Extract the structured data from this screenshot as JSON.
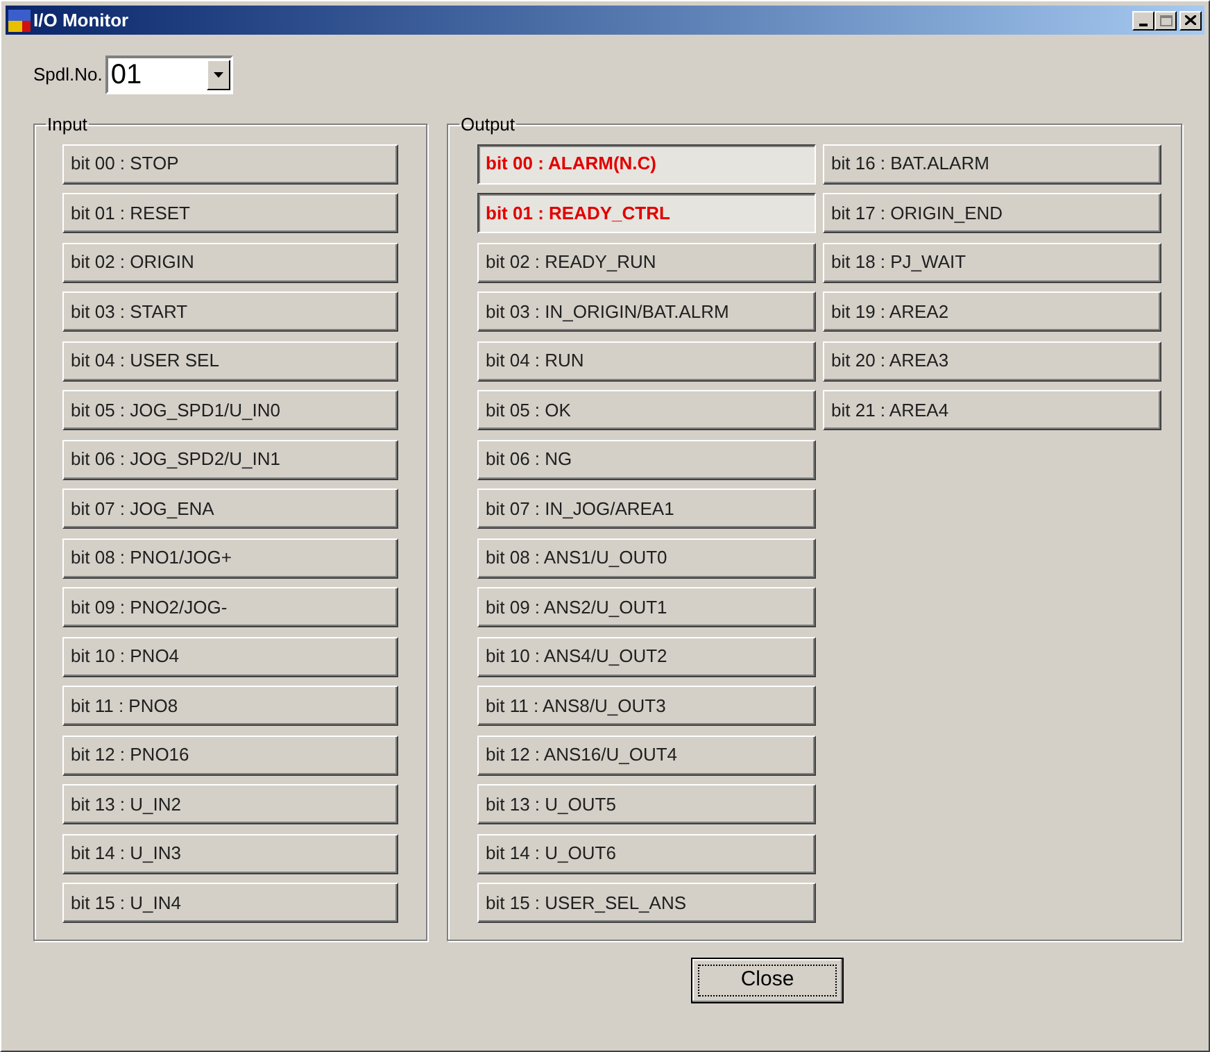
{
  "window": {
    "title": "I/O Monitor"
  },
  "spindle": {
    "label": "Spdl.No.",
    "value": "01"
  },
  "input": {
    "title": "Input",
    "bits": [
      {
        "label": "bit 00 : STOP",
        "on": false
      },
      {
        "label": "bit 01 : RESET",
        "on": false
      },
      {
        "label": "bit 02 : ORIGIN",
        "on": false
      },
      {
        "label": "bit 03 : START",
        "on": false
      },
      {
        "label": "bit 04 : USER SEL",
        "on": false
      },
      {
        "label": "bit 05 : JOG_SPD1/U_IN0",
        "on": false
      },
      {
        "label": "bit 06 : JOG_SPD2/U_IN1",
        "on": false
      },
      {
        "label": "bit 07 : JOG_ENA",
        "on": false
      },
      {
        "label": "bit 08 : PNO1/JOG+",
        "on": false
      },
      {
        "label": "bit 09 : PNO2/JOG-",
        "on": false
      },
      {
        "label": "bit 10 : PNO4",
        "on": false
      },
      {
        "label": "bit 11 : PNO8",
        "on": false
      },
      {
        "label": "bit 12 : PNO16",
        "on": false
      },
      {
        "label": "bit 13 : U_IN2",
        "on": false
      },
      {
        "label": "bit 14 : U_IN3",
        "on": false
      },
      {
        "label": "bit 15 : U_IN4",
        "on": false
      }
    ]
  },
  "output": {
    "title": "Output",
    "bits": [
      {
        "label": "bit 00 : ALARM(N.C)",
        "on": true
      },
      {
        "label": "bit 01 : READY_CTRL",
        "on": true
      },
      {
        "label": "bit 02 : READY_RUN",
        "on": false
      },
      {
        "label": "bit 03 : IN_ORIGIN/BAT.ALRM",
        "on": false
      },
      {
        "label": "bit 04 : RUN",
        "on": false
      },
      {
        "label": "bit 05 : OK",
        "on": false
      },
      {
        "label": "bit 06 : NG",
        "on": false
      },
      {
        "label": "bit 07 : IN_JOG/AREA1",
        "on": false
      },
      {
        "label": "bit 08 : ANS1/U_OUT0",
        "on": false
      },
      {
        "label": "bit 09 : ANS2/U_OUT1",
        "on": false
      },
      {
        "label": "bit 10 : ANS4/U_OUT2",
        "on": false
      },
      {
        "label": "bit 11 : ANS8/U_OUT3",
        "on": false
      },
      {
        "label": "bit 12 : ANS16/U_OUT4",
        "on": false
      },
      {
        "label": "bit 13 : U_OUT5",
        "on": false
      },
      {
        "label": "bit 14 : U_OUT6",
        "on": false
      },
      {
        "label": "bit 15 : USER_SEL_ANS",
        "on": false
      },
      {
        "label": "bit 16 : BAT.ALARM",
        "on": false
      },
      {
        "label": "bit 17 : ORIGIN_END",
        "on": false
      },
      {
        "label": "bit 18 : PJ_WAIT",
        "on": false
      },
      {
        "label": "bit 19 : AREA2",
        "on": false
      },
      {
        "label": "bit 20 : AREA3",
        "on": false
      },
      {
        "label": "bit 21 : AREA4",
        "on": false
      }
    ]
  },
  "close_button": {
    "label": "Close"
  }
}
